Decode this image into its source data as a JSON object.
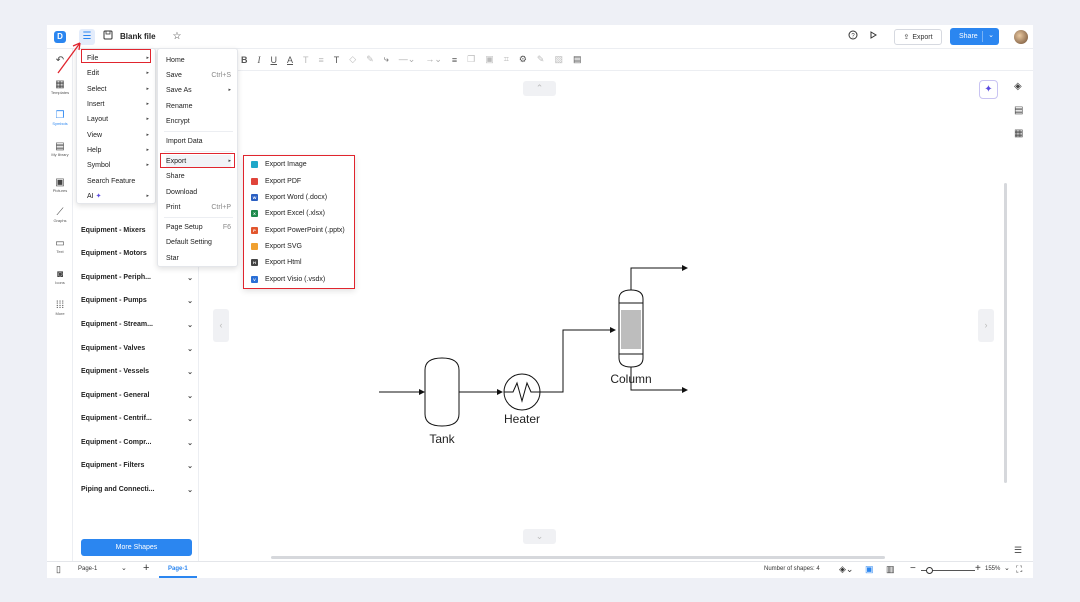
{
  "window": {
    "title": "Blank file"
  },
  "topbar": {
    "export_label": "Export",
    "share_label": "Share"
  },
  "left_rail": [
    {
      "label": "Templates",
      "icon": "templates-icon"
    },
    {
      "label": "Symbols",
      "icon": "symbols-icon"
    },
    {
      "label": "My library",
      "icon": "my-library-icon"
    },
    {
      "label": "Pictures",
      "icon": "pictures-icon"
    },
    {
      "label": "Graphs",
      "icon": "graphs-icon"
    },
    {
      "label": "Text",
      "icon": "text-icon"
    },
    {
      "label": "Icons",
      "icon": "icons-icon"
    },
    {
      "label": "More",
      "icon": "more-icon"
    }
  ],
  "library": {
    "categories": [
      "Equipment - Mixers",
      "Equipment - Motors",
      "Equipment - Periph...",
      "Equipment - Pumps",
      "Equipment - Stream...",
      "Equipment - Valves",
      "Equipment - Vessels",
      "Equipment - General",
      "Equipment - Centrif...",
      "Equipment - Compr...",
      "Equipment - Filters",
      "Piping and Connecti..."
    ],
    "more_shapes": "More Shapes"
  },
  "main_menu": [
    {
      "label": "File"
    },
    {
      "label": "Edit"
    },
    {
      "label": "Select"
    },
    {
      "label": "Insert"
    },
    {
      "label": "Layout"
    },
    {
      "label": "View"
    },
    {
      "label": "Help"
    },
    {
      "label": "Symbol"
    },
    {
      "label": "Search Feature"
    },
    {
      "label": "AI"
    }
  ],
  "file_menu": [
    {
      "label": "Home",
      "shortcut": ""
    },
    {
      "label": "Save",
      "shortcut": "Ctrl+S"
    },
    {
      "label": "Save As",
      "shortcut": ""
    },
    {
      "label": "Rename",
      "shortcut": ""
    },
    {
      "label": "Encrypt",
      "shortcut": ""
    },
    {
      "label": "Import Data",
      "shortcut": ""
    },
    {
      "label": "Export",
      "shortcut": ""
    },
    {
      "label": "Share",
      "shortcut": ""
    },
    {
      "label": "Download",
      "shortcut": ""
    },
    {
      "label": "Print",
      "shortcut": "Ctrl+P"
    },
    {
      "label": "Page Setup",
      "shortcut": "F6"
    },
    {
      "label": "Default Setting",
      "shortcut": ""
    },
    {
      "label": "Star",
      "shortcut": ""
    }
  ],
  "export_menu": [
    {
      "label": "Export Image",
      "color": "#1fa7c9",
      "tag": "▲"
    },
    {
      "label": "Export PDF",
      "color": "#e0443a",
      "tag": "PDF"
    },
    {
      "label": "Export Word (.docx)",
      "color": "#2b5fc2",
      "tag": "W"
    },
    {
      "label": "Export Excel (.xlsx)",
      "color": "#1e8a4c",
      "tag": "X"
    },
    {
      "label": "Export PowerPoint (.pptx)",
      "color": "#e2562d",
      "tag": "P"
    },
    {
      "label": "Export SVG",
      "color": "#f0a030",
      "tag": "SVG"
    },
    {
      "label": "Export Html",
      "color": "#444444",
      "tag": "H"
    },
    {
      "label": "Export Visio (.vsdx)",
      "color": "#2a6fd6",
      "tag": "V"
    }
  ],
  "diagram": {
    "tank": "Tank",
    "heater": "Heater",
    "column": "Column"
  },
  "bottombar": {
    "page_select": "Page-1",
    "page_tab": "Page-1",
    "shape_count": "Number of shapes: 4",
    "zoom": "155%"
  }
}
